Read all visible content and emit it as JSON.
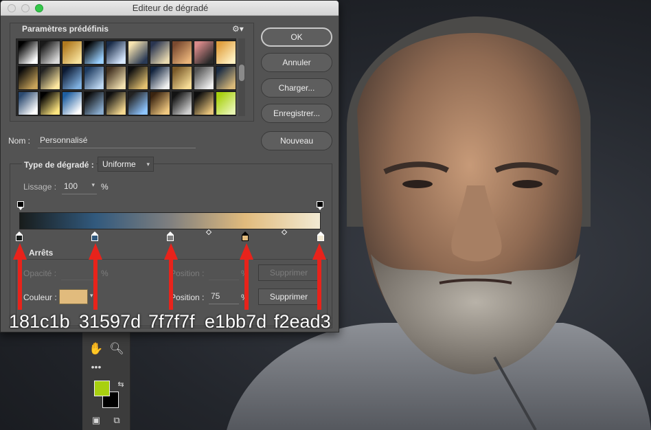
{
  "dialog": {
    "title": "Editeur de dégradé",
    "presets_label": "Paramètres prédéfinis",
    "gear_icon": "gear-icon",
    "name_label": "Nom :",
    "name_value": "Personnalisé",
    "type_label": "Type de dégradé :",
    "type_value": "Uniforme",
    "smoothing_label": "Lissage :",
    "smoothing_value": "100",
    "percent": "%",
    "stops_label": "Arrêts",
    "opacity_label": "Opacité :",
    "color_label": "Couleur :",
    "position_label": "Position :",
    "position_value": "75",
    "delete_label": "Supprimer"
  },
  "buttons": {
    "ok": "OK",
    "cancel": "Annuler",
    "load": "Charger...",
    "save": "Enregistrer...",
    "new": "Nouveau"
  },
  "gradient": {
    "stops": [
      "#181c1b",
      "#31597d",
      "#7f7f7f",
      "#e1bb7d",
      "#f2ead3"
    ],
    "positions_percent": [
      0,
      25,
      50,
      75,
      100
    ],
    "selected_color": "#e1bb7d"
  },
  "annotations": {
    "hex_labels": [
      "181c1b",
      "31597d",
      "7f7f7f",
      "e1bb7d",
      "f2ead3"
    ],
    "arrow_color": "#e8231b"
  },
  "tools": {
    "foreground_color": "#a8d010",
    "background_color": "#000000"
  }
}
